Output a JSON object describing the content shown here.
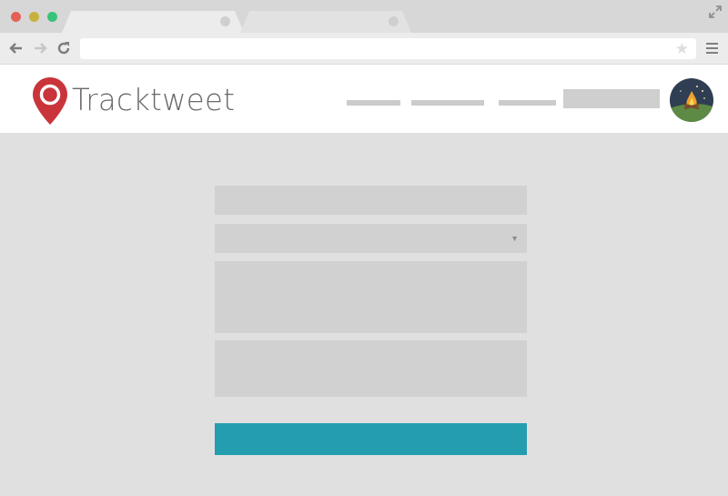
{
  "window": {
    "controls": [
      "close",
      "minimize",
      "maximize"
    ],
    "colors": {
      "close": "#e56158",
      "minimize": "#c7b13f",
      "maximize": "#39c37a"
    }
  },
  "browser": {
    "tabs": [
      {
        "label": "",
        "active": true
      },
      {
        "label": "",
        "active": false
      }
    ],
    "address_bar": {
      "value": "",
      "placeholder": ""
    },
    "icons": [
      "back-arrow-icon",
      "forward-arrow-icon",
      "reload-icon",
      "star-icon",
      "menu-icon",
      "expand-icon"
    ]
  },
  "site": {
    "brand": {
      "name": "Tracktweet",
      "pin_color": "#c9353b"
    },
    "nav": {
      "items": [
        "",
        "",
        ""
      ],
      "cta": ""
    },
    "avatar": {
      "icon": "campfire-icon"
    }
  },
  "form": {
    "fields": [
      {
        "type": "text",
        "value": "",
        "placeholder": ""
      },
      {
        "type": "select",
        "value": ""
      },
      {
        "type": "textarea",
        "value": "",
        "placeholder": ""
      },
      {
        "type": "textarea",
        "value": "",
        "placeholder": ""
      }
    ],
    "submit_label": "",
    "accent": "#249db0"
  }
}
